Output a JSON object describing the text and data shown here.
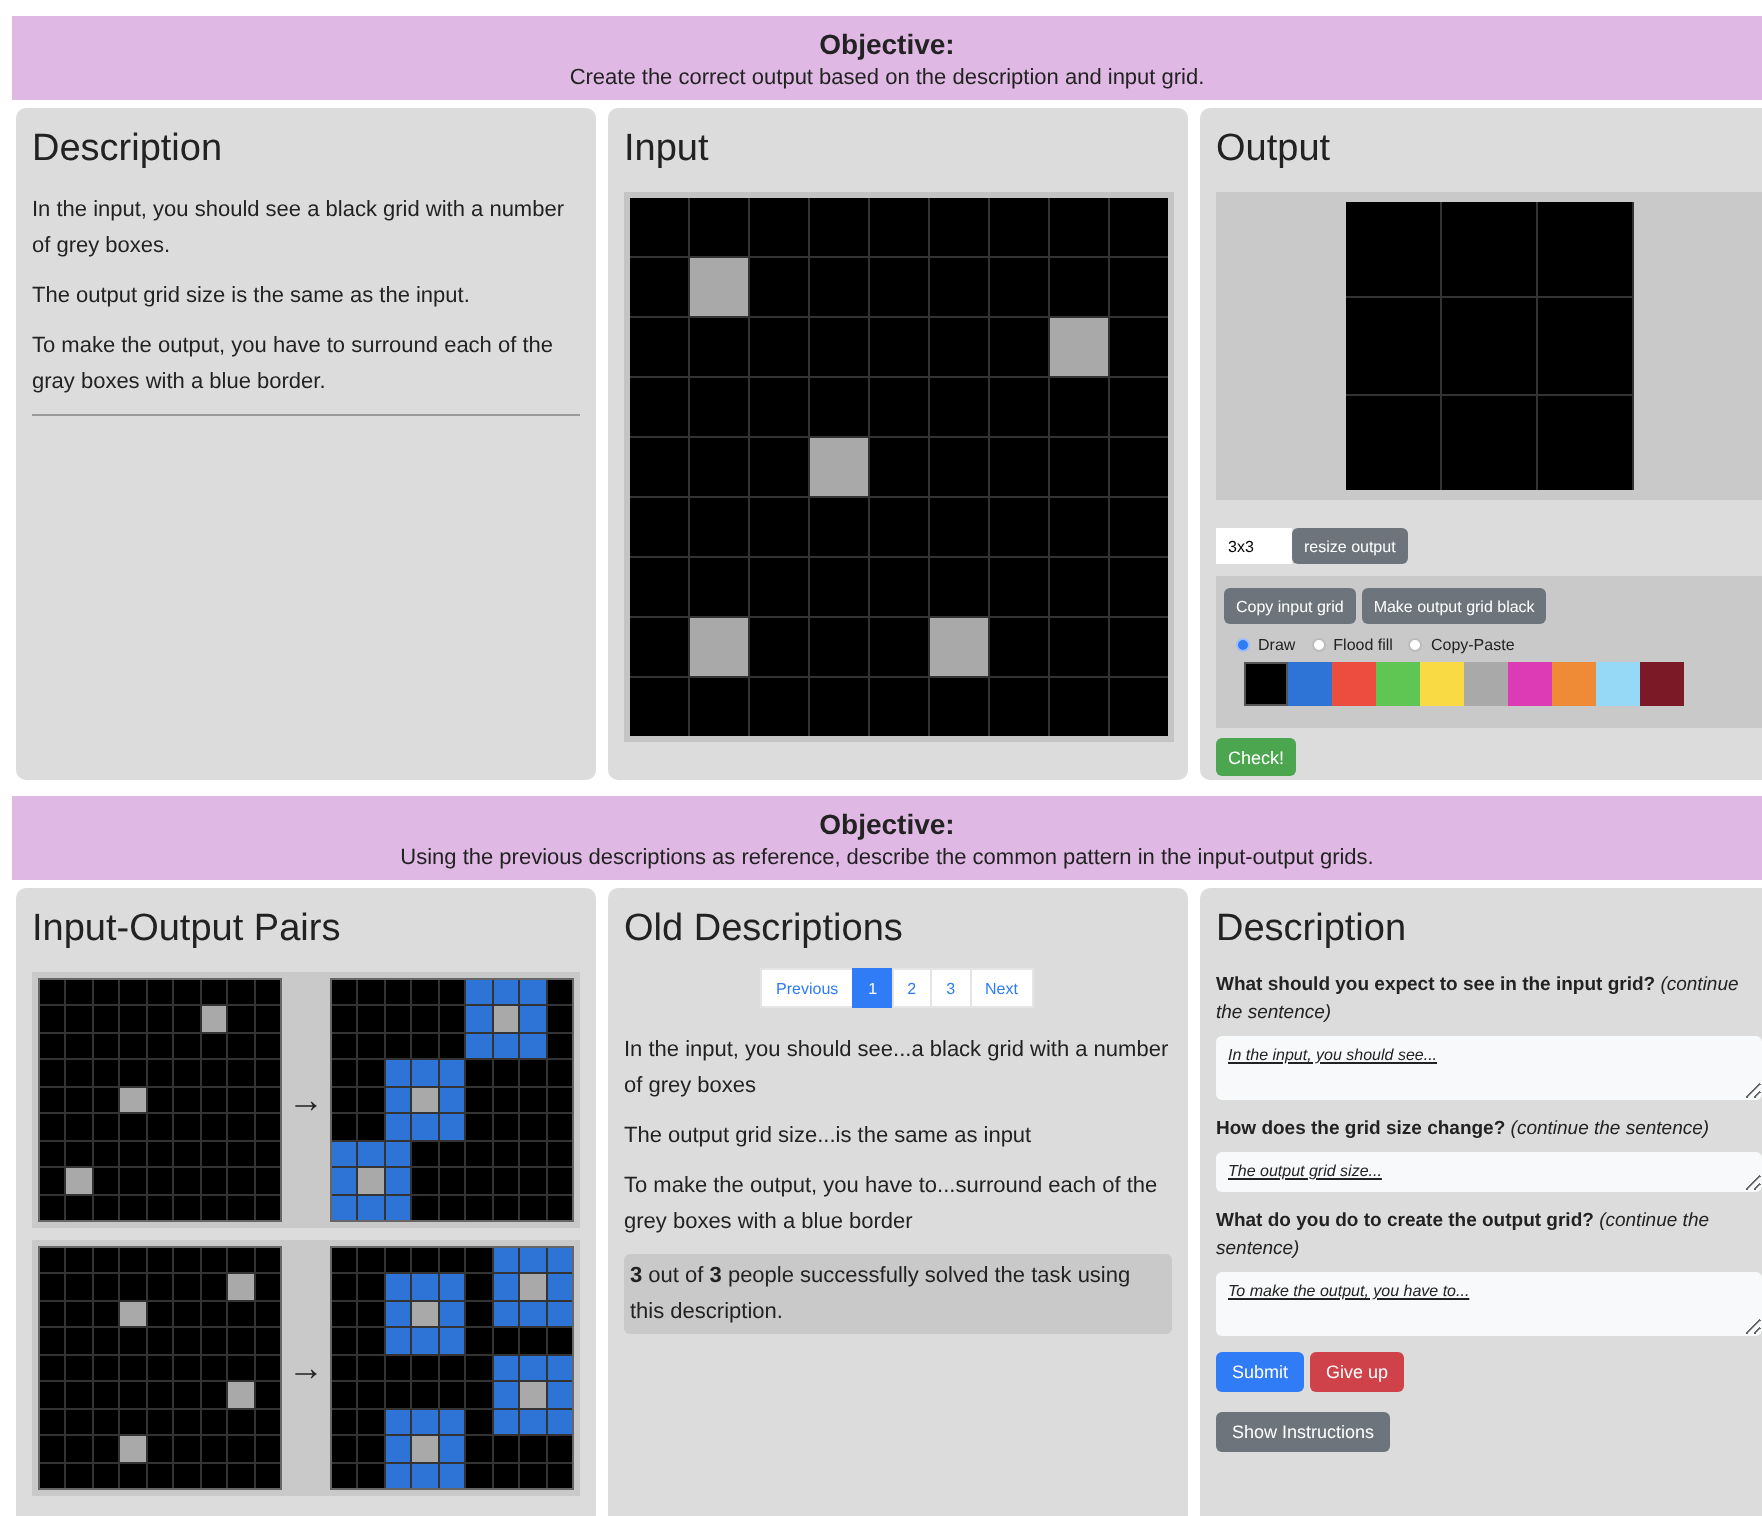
{
  "objective_top": {
    "title": "Objective:",
    "text": "Create the correct output based on the description and input grid."
  },
  "description_panel": {
    "title": "Description",
    "paragraphs": [
      "In the input, you should see a black grid with a number of grey boxes.",
      "The output grid size is the same as the input.",
      "To make the output, you have to surround each of the gray boxes with a blue border."
    ]
  },
  "input_panel": {
    "title": "Input",
    "grid": [
      [
        {
          "color": "#000000"
        },
        {
          "color": "#000000"
        },
        {
          "color": "#000000"
        },
        {
          "color": "#000000"
        },
        {
          "color": "#000000"
        },
        {
          "color": "#000000"
        },
        {
          "color": "#000000"
        },
        {
          "color": "#000000"
        },
        {
          "color": "#000000"
        }
      ],
      [
        {
          "color": "#000000"
        },
        {
          "color": "#a9a9a9"
        },
        {
          "color": "#000000"
        },
        {
          "color": "#000000"
        },
        {
          "color": "#000000"
        },
        {
          "color": "#000000"
        },
        {
          "color": "#000000"
        },
        {
          "color": "#000000"
        },
        {
          "color": "#000000"
        }
      ],
      [
        {
          "color": "#000000"
        },
        {
          "color": "#000000"
        },
        {
          "color": "#000000"
        },
        {
          "color": "#000000"
        },
        {
          "color": "#000000"
        },
        {
          "color": "#000000"
        },
        {
          "color": "#000000"
        },
        {
          "color": "#a9a9a9"
        },
        {
          "color": "#000000"
        }
      ],
      [
        {
          "color": "#000000"
        },
        {
          "color": "#000000"
        },
        {
          "color": "#000000"
        },
        {
          "color": "#000000"
        },
        {
          "color": "#000000"
        },
        {
          "color": "#000000"
        },
        {
          "color": "#000000"
        },
        {
          "color": "#000000"
        },
        {
          "color": "#000000"
        }
      ],
      [
        {
          "color": "#000000"
        },
        {
          "color": "#000000"
        },
        {
          "color": "#000000"
        },
        {
          "color": "#a9a9a9"
        },
        {
          "color": "#000000"
        },
        {
          "color": "#000000"
        },
        {
          "color": "#000000"
        },
        {
          "color": "#000000"
        },
        {
          "color": "#000000"
        }
      ],
      [
        {
          "color": "#000000"
        },
        {
          "color": "#000000"
        },
        {
          "color": "#000000"
        },
        {
          "color": "#000000"
        },
        {
          "color": "#000000"
        },
        {
          "color": "#000000"
        },
        {
          "color": "#000000"
        },
        {
          "color": "#000000"
        },
        {
          "color": "#000000"
        }
      ],
      [
        {
          "color": "#000000"
        },
        {
          "color": "#000000"
        },
        {
          "color": "#000000"
        },
        {
          "color": "#000000"
        },
        {
          "color": "#000000"
        },
        {
          "color": "#000000"
        },
        {
          "color": "#000000"
        },
        {
          "color": "#000000"
        },
        {
          "color": "#000000"
        }
      ],
      [
        {
          "color": "#000000"
        },
        {
          "color": "#a9a9a9"
        },
        {
          "color": "#000000"
        },
        {
          "color": "#000000"
        },
        {
          "color": "#000000"
        },
        {
          "color": "#a9a9a9"
        },
        {
          "color": "#000000"
        },
        {
          "color": "#000000"
        },
        {
          "color": "#000000"
        }
      ],
      [
        {
          "color": "#000000"
        },
        {
          "color": "#000000"
        },
        {
          "color": "#000000"
        },
        {
          "color": "#000000"
        },
        {
          "color": "#000000"
        },
        {
          "color": "#000000"
        },
        {
          "color": "#000000"
        },
        {
          "color": "#000000"
        },
        {
          "color": "#000000"
        }
      ]
    ]
  },
  "output_panel": {
    "title": "Output",
    "grid": [
      [
        {
          "color": "#000000"
        },
        {
          "color": "#000000"
        },
        {
          "color": "#000000"
        }
      ],
      [
        {
          "color": "#000000"
        },
        {
          "color": "#000000"
        },
        {
          "color": "#000000"
        }
      ],
      [
        {
          "color": "#000000"
        },
        {
          "color": "#000000"
        },
        {
          "color": "#000000"
        }
      ]
    ],
    "size_field": {
      "value": "3x3"
    },
    "resize_button": "resize output",
    "tool_buttons": [
      "Copy input grid",
      "Make output grid black"
    ],
    "modes": [
      {
        "label": "Draw",
        "selected": true
      },
      {
        "label": "Flood fill",
        "selected": false
      },
      {
        "label": "Copy-Paste",
        "selected": false
      }
    ],
    "swatches": [
      {
        "color": "#000000",
        "selected": true
      },
      {
        "color": "#2e74d6",
        "selected": false
      },
      {
        "color": "#ec4d3f",
        "selected": false
      },
      {
        "color": "#5fc653",
        "selected": false
      },
      {
        "color": "#f9d944",
        "selected": false
      },
      {
        "color": "#a9a9a9",
        "selected": false
      },
      {
        "color": "#dd3ab5",
        "selected": false
      },
      {
        "color": "#ef8a36",
        "selected": false
      },
      {
        "color": "#95d9f7",
        "selected": false
      },
      {
        "color": "#7b1a26",
        "selected": false
      }
    ],
    "check_button": "Check!"
  },
  "objective_bottom": {
    "title": "Objective:",
    "text": "Using the previous descriptions as reference, describe the common pattern in the input-output grids."
  },
  "pairs_panel": {
    "title": "Input-Output Pairs",
    "pairs": [
      {
        "input": [
          [
            {
              "color": "#000000"
            },
            {
              "color": "#000000"
            },
            {
              "color": "#000000"
            },
            {
              "color": "#000000"
            },
            {
              "color": "#000000"
            },
            {
              "color": "#000000"
            },
            {
              "color": "#000000"
            },
            {
              "color": "#000000"
            },
            {
              "color": "#000000"
            }
          ],
          [
            {
              "color": "#000000"
            },
            {
              "color": "#000000"
            },
            {
              "color": "#000000"
            },
            {
              "color": "#000000"
            },
            {
              "color": "#000000"
            },
            {
              "color": "#000000"
            },
            {
              "color": "#a9a9a9"
            },
            {
              "color": "#000000"
            },
            {
              "color": "#000000"
            }
          ],
          [
            {
              "color": "#000000"
            },
            {
              "color": "#000000"
            },
            {
              "color": "#000000"
            },
            {
              "color": "#000000"
            },
            {
              "color": "#000000"
            },
            {
              "color": "#000000"
            },
            {
              "color": "#000000"
            },
            {
              "color": "#000000"
            },
            {
              "color": "#000000"
            }
          ],
          [
            {
              "color": "#000000"
            },
            {
              "color": "#000000"
            },
            {
              "color": "#000000"
            },
            {
              "color": "#000000"
            },
            {
              "color": "#000000"
            },
            {
              "color": "#000000"
            },
            {
              "color": "#000000"
            },
            {
              "color": "#000000"
            },
            {
              "color": "#000000"
            }
          ],
          [
            {
              "color": "#000000"
            },
            {
              "color": "#000000"
            },
            {
              "color": "#000000"
            },
            {
              "color": "#a9a9a9"
            },
            {
              "color": "#000000"
            },
            {
              "color": "#000000"
            },
            {
              "color": "#000000"
            },
            {
              "color": "#000000"
            },
            {
              "color": "#000000"
            }
          ],
          [
            {
              "color": "#000000"
            },
            {
              "color": "#000000"
            },
            {
              "color": "#000000"
            },
            {
              "color": "#000000"
            },
            {
              "color": "#000000"
            },
            {
              "color": "#000000"
            },
            {
              "color": "#000000"
            },
            {
              "color": "#000000"
            },
            {
              "color": "#000000"
            }
          ],
          [
            {
              "color": "#000000"
            },
            {
              "color": "#000000"
            },
            {
              "color": "#000000"
            },
            {
              "color": "#000000"
            },
            {
              "color": "#000000"
            },
            {
              "color": "#000000"
            },
            {
              "color": "#000000"
            },
            {
              "color": "#000000"
            },
            {
              "color": "#000000"
            }
          ],
          [
            {
              "color": "#000000"
            },
            {
              "color": "#a9a9a9"
            },
            {
              "color": "#000000"
            },
            {
              "color": "#000000"
            },
            {
              "color": "#000000"
            },
            {
              "color": "#000000"
            },
            {
              "color": "#000000"
            },
            {
              "color": "#000000"
            },
            {
              "color": "#000000"
            }
          ],
          [
            {
              "color": "#000000"
            },
            {
              "color": "#000000"
            },
            {
              "color": "#000000"
            },
            {
              "color": "#000000"
            },
            {
              "color": "#000000"
            },
            {
              "color": "#000000"
            },
            {
              "color": "#000000"
            },
            {
              "color": "#000000"
            },
            {
              "color": "#000000"
            }
          ]
        ],
        "arrow": "→",
        "output": [
          [
            {
              "color": "#000000"
            },
            {
              "color": "#000000"
            },
            {
              "color": "#000000"
            },
            {
              "color": "#000000"
            },
            {
              "color": "#000000"
            },
            {
              "color": "#2e74d6"
            },
            {
              "color": "#2e74d6"
            },
            {
              "color": "#2e74d6"
            },
            {
              "color": "#000000"
            }
          ],
          [
            {
              "color": "#000000"
            },
            {
              "color": "#000000"
            },
            {
              "color": "#000000"
            },
            {
              "color": "#000000"
            },
            {
              "color": "#000000"
            },
            {
              "color": "#2e74d6"
            },
            {
              "color": "#a9a9a9"
            },
            {
              "color": "#2e74d6"
            },
            {
              "color": "#000000"
            }
          ],
          [
            {
              "color": "#000000"
            },
            {
              "color": "#000000"
            },
            {
              "color": "#000000"
            },
            {
              "color": "#000000"
            },
            {
              "color": "#000000"
            },
            {
              "color": "#2e74d6"
            },
            {
              "color": "#2e74d6"
            },
            {
              "color": "#2e74d6"
            },
            {
              "color": "#000000"
            }
          ],
          [
            {
              "color": "#000000"
            },
            {
              "color": "#000000"
            },
            {
              "color": "#2e74d6"
            },
            {
              "color": "#2e74d6"
            },
            {
              "color": "#2e74d6"
            },
            {
              "color": "#000000"
            },
            {
              "color": "#000000"
            },
            {
              "color": "#000000"
            },
            {
              "color": "#000000"
            }
          ],
          [
            {
              "color": "#000000"
            },
            {
              "color": "#000000"
            },
            {
              "color": "#2e74d6"
            },
            {
              "color": "#a9a9a9"
            },
            {
              "color": "#2e74d6"
            },
            {
              "color": "#000000"
            },
            {
              "color": "#000000"
            },
            {
              "color": "#000000"
            },
            {
              "color": "#000000"
            }
          ],
          [
            {
              "color": "#000000"
            },
            {
              "color": "#000000"
            },
            {
              "color": "#2e74d6"
            },
            {
              "color": "#2e74d6"
            },
            {
              "color": "#2e74d6"
            },
            {
              "color": "#000000"
            },
            {
              "color": "#000000"
            },
            {
              "color": "#000000"
            },
            {
              "color": "#000000"
            }
          ],
          [
            {
              "color": "#2e74d6"
            },
            {
              "color": "#2e74d6"
            },
            {
              "color": "#2e74d6"
            },
            {
              "color": "#000000"
            },
            {
              "color": "#000000"
            },
            {
              "color": "#000000"
            },
            {
              "color": "#000000"
            },
            {
              "color": "#000000"
            },
            {
              "color": "#000000"
            }
          ],
          [
            {
              "color": "#2e74d6"
            },
            {
              "color": "#a9a9a9"
            },
            {
              "color": "#2e74d6"
            },
            {
              "color": "#000000"
            },
            {
              "color": "#000000"
            },
            {
              "color": "#000000"
            },
            {
              "color": "#000000"
            },
            {
              "color": "#000000"
            },
            {
              "color": "#000000"
            }
          ],
          [
            {
              "color": "#2e74d6"
            },
            {
              "color": "#2e74d6"
            },
            {
              "color": "#2e74d6"
            },
            {
              "color": "#000000"
            },
            {
              "color": "#000000"
            },
            {
              "color": "#000000"
            },
            {
              "color": "#000000"
            },
            {
              "color": "#000000"
            },
            {
              "color": "#000000"
            }
          ]
        ]
      },
      {
        "input": [
          [
            {
              "color": "#000000"
            },
            {
              "color": "#000000"
            },
            {
              "color": "#000000"
            },
            {
              "color": "#000000"
            },
            {
              "color": "#000000"
            },
            {
              "color": "#000000"
            },
            {
              "color": "#000000"
            },
            {
              "color": "#000000"
            },
            {
              "color": "#000000"
            }
          ],
          [
            {
              "color": "#000000"
            },
            {
              "color": "#000000"
            },
            {
              "color": "#000000"
            },
            {
              "color": "#000000"
            },
            {
              "color": "#000000"
            },
            {
              "color": "#000000"
            },
            {
              "color": "#000000"
            },
            {
              "color": "#a9a9a9"
            },
            {
              "color": "#000000"
            }
          ],
          [
            {
              "color": "#000000"
            },
            {
              "color": "#000000"
            },
            {
              "color": "#000000"
            },
            {
              "color": "#a9a9a9"
            },
            {
              "color": "#000000"
            },
            {
              "color": "#000000"
            },
            {
              "color": "#000000"
            },
            {
              "color": "#000000"
            },
            {
              "color": "#000000"
            }
          ],
          [
            {
              "color": "#000000"
            },
            {
              "color": "#000000"
            },
            {
              "color": "#000000"
            },
            {
              "color": "#000000"
            },
            {
              "color": "#000000"
            },
            {
              "color": "#000000"
            },
            {
              "color": "#000000"
            },
            {
              "color": "#000000"
            },
            {
              "color": "#000000"
            }
          ],
          [
            {
              "color": "#000000"
            },
            {
              "color": "#000000"
            },
            {
              "color": "#000000"
            },
            {
              "color": "#000000"
            },
            {
              "color": "#000000"
            },
            {
              "color": "#000000"
            },
            {
              "color": "#000000"
            },
            {
              "color": "#000000"
            },
            {
              "color": "#000000"
            }
          ],
          [
            {
              "color": "#000000"
            },
            {
              "color": "#000000"
            },
            {
              "color": "#000000"
            },
            {
              "color": "#000000"
            },
            {
              "color": "#000000"
            },
            {
              "color": "#000000"
            },
            {
              "color": "#000000"
            },
            {
              "color": "#a9a9a9"
            },
            {
              "color": "#000000"
            }
          ],
          [
            {
              "color": "#000000"
            },
            {
              "color": "#000000"
            },
            {
              "color": "#000000"
            },
            {
              "color": "#000000"
            },
            {
              "color": "#000000"
            },
            {
              "color": "#000000"
            },
            {
              "color": "#000000"
            },
            {
              "color": "#000000"
            },
            {
              "color": "#000000"
            }
          ],
          [
            {
              "color": "#000000"
            },
            {
              "color": "#000000"
            },
            {
              "color": "#000000"
            },
            {
              "color": "#a9a9a9"
            },
            {
              "color": "#000000"
            },
            {
              "color": "#000000"
            },
            {
              "color": "#000000"
            },
            {
              "color": "#000000"
            },
            {
              "color": "#000000"
            }
          ],
          [
            {
              "color": "#000000"
            },
            {
              "color": "#000000"
            },
            {
              "color": "#000000"
            },
            {
              "color": "#000000"
            },
            {
              "color": "#000000"
            },
            {
              "color": "#000000"
            },
            {
              "color": "#000000"
            },
            {
              "color": "#000000"
            },
            {
              "color": "#000000"
            }
          ]
        ],
        "arrow": "→",
        "output": [
          [
            {
              "color": "#000000"
            },
            {
              "color": "#000000"
            },
            {
              "color": "#000000"
            },
            {
              "color": "#000000"
            },
            {
              "color": "#000000"
            },
            {
              "color": "#000000"
            },
            {
              "color": "#2e74d6"
            },
            {
              "color": "#2e74d6"
            },
            {
              "color": "#2e74d6"
            }
          ],
          [
            {
              "color": "#000000"
            },
            {
              "color": "#000000"
            },
            {
              "color": "#2e74d6"
            },
            {
              "color": "#2e74d6"
            },
            {
              "color": "#2e74d6"
            },
            {
              "color": "#000000"
            },
            {
              "color": "#2e74d6"
            },
            {
              "color": "#a9a9a9"
            },
            {
              "color": "#2e74d6"
            }
          ],
          [
            {
              "color": "#000000"
            },
            {
              "color": "#000000"
            },
            {
              "color": "#2e74d6"
            },
            {
              "color": "#a9a9a9"
            },
            {
              "color": "#2e74d6"
            },
            {
              "color": "#000000"
            },
            {
              "color": "#2e74d6"
            },
            {
              "color": "#2e74d6"
            },
            {
              "color": "#2e74d6"
            }
          ],
          [
            {
              "color": "#000000"
            },
            {
              "color": "#000000"
            },
            {
              "color": "#2e74d6"
            },
            {
              "color": "#2e74d6"
            },
            {
              "color": "#2e74d6"
            },
            {
              "color": "#000000"
            },
            {
              "color": "#000000"
            },
            {
              "color": "#000000"
            },
            {
              "color": "#000000"
            }
          ],
          [
            {
              "color": "#000000"
            },
            {
              "color": "#000000"
            },
            {
              "color": "#000000"
            },
            {
              "color": "#000000"
            },
            {
              "color": "#000000"
            },
            {
              "color": "#000000"
            },
            {
              "color": "#2e74d6"
            },
            {
              "color": "#2e74d6"
            },
            {
              "color": "#2e74d6"
            }
          ],
          [
            {
              "color": "#000000"
            },
            {
              "color": "#000000"
            },
            {
              "color": "#000000"
            },
            {
              "color": "#000000"
            },
            {
              "color": "#000000"
            },
            {
              "color": "#000000"
            },
            {
              "color": "#2e74d6"
            },
            {
              "color": "#a9a9a9"
            },
            {
              "color": "#2e74d6"
            }
          ],
          [
            {
              "color": "#000000"
            },
            {
              "color": "#000000"
            },
            {
              "color": "#2e74d6"
            },
            {
              "color": "#2e74d6"
            },
            {
              "color": "#2e74d6"
            },
            {
              "color": "#000000"
            },
            {
              "color": "#2e74d6"
            },
            {
              "color": "#2e74d6"
            },
            {
              "color": "#2e74d6"
            }
          ],
          [
            {
              "color": "#000000"
            },
            {
              "color": "#000000"
            },
            {
              "color": "#2e74d6"
            },
            {
              "color": "#a9a9a9"
            },
            {
              "color": "#2e74d6"
            },
            {
              "color": "#000000"
            },
            {
              "color": "#000000"
            },
            {
              "color": "#000000"
            },
            {
              "color": "#000000"
            }
          ],
          [
            {
              "color": "#000000"
            },
            {
              "color": "#000000"
            },
            {
              "color": "#2e74d6"
            },
            {
              "color": "#2e74d6"
            },
            {
              "color": "#2e74d6"
            },
            {
              "color": "#000000"
            },
            {
              "color": "#000000"
            },
            {
              "color": "#000000"
            },
            {
              "color": "#000000"
            }
          ]
        ]
      }
    ]
  },
  "old_descriptions": {
    "title": "Old Descriptions",
    "pagination": [
      {
        "label": "Previous",
        "selected": false
      },
      {
        "label": "1",
        "selected": true
      },
      {
        "label": "2",
        "selected": false
      },
      {
        "label": "3",
        "selected": false
      },
      {
        "label": "Next",
        "selected": false
      }
    ],
    "paragraphs": [
      "In the input, you should see...a black grid with a number of grey boxes",
      "The output grid size...is the same as input",
      "To make the output, you have to...surround each of the grey boxes with a blue border"
    ],
    "success_note": "**3** out of **3** people successfully solved the task using this description."
  },
  "description_form": {
    "title": "Description",
    "questions": [
      {
        "prompt": "**What should you expect to see in the input grid?** *(continue the sentence)*",
        "placeholder": "In the input, you should see...",
        "tall": true
      },
      {
        "prompt": "**How does the grid size change?** *(continue the sentence)*",
        "placeholder": "The output grid size...",
        "tall": false
      },
      {
        "prompt": "**What do you do to create the output grid?** *(continue the sentence)*",
        "placeholder": "To make the output, you have to...",
        "tall": true
      }
    ],
    "submit_button": "Submit",
    "give_up_button": "Give up",
    "instructions_button": "Show Instructions"
  }
}
